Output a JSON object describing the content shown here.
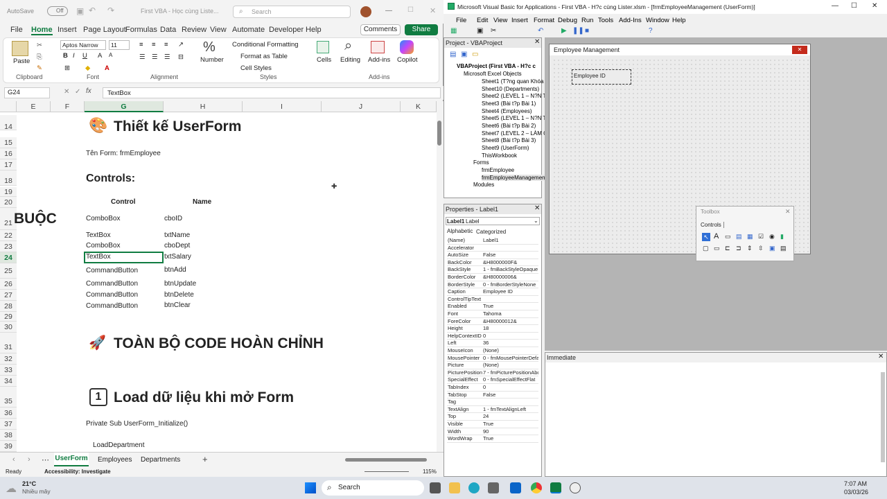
{
  "excel": {
    "title": {
      "autosave": "AutoSave",
      "toggle": "Off",
      "doc": "First VBA - Học cùng Liste...",
      "search_placeholder": "Search"
    },
    "tabs": [
      "File",
      "Home",
      "Insert",
      "Page Layout",
      "Formulas",
      "Data",
      "Review",
      "View",
      "Automate",
      "Developer",
      "Help"
    ],
    "comments": "Comments",
    "share": "Share",
    "ribbon": {
      "paste": "Paste",
      "clipboard": "Clipboard",
      "font_name": "Aptos Narrow",
      "font_size": "11",
      "font": "Font",
      "alignment": "Alignment",
      "number": "Number",
      "cond_format": "Conditional Formatting",
      "format_table": "Format as Table",
      "cell_styles": "Cell Styles",
      "styles": "Styles",
      "cells": "Cells",
      "editing": "Editing",
      "addins": "Add-ins",
      "addins_group": "Add-ins",
      "copilot": "Copilot"
    },
    "namebox": "G24",
    "formula": "TextBox",
    "columns": [
      "E",
      "F",
      "G",
      "H",
      "I",
      "J",
      "K"
    ],
    "rows": [
      "14",
      "15",
      "16",
      "17",
      "18",
      "19",
      "20",
      "21",
      "22",
      "23",
      "24",
      "25",
      "26",
      "27",
      "28",
      "29",
      "30",
      "31",
      "32",
      "33",
      "34",
      "35",
      "36",
      "37",
      "38",
      "39"
    ],
    "cells": {
      "title1": "Thiết kế UserForm",
      "form_name": "Tên Form: frmEmployee",
      "controls": "Controls:",
      "hdr_control": "Control",
      "hdr_name": "Name",
      "buoc": "BUỘC",
      "ctrl_rows": [
        [
          "ComboBox",
          "cboID"
        ],
        [
          "TextBox",
          "txtName"
        ],
        [
          "ComboBox",
          "cboDept"
        ],
        [
          "TextBox",
          "txtSalary"
        ],
        [
          "CommandButton",
          "btnAdd"
        ],
        [
          "CommandButton",
          "btnUpdate"
        ],
        [
          "CommandButton",
          "btnDelete"
        ],
        [
          "CommandButton",
          "btnClear"
        ]
      ],
      "title2": "TOÀN BỘ CODE HOÀN CHỈNH",
      "title3": "Load dữ liệu khi mở Form",
      "num": "1",
      "code1": "Private Sub UserForm_Initialize()",
      "code2": "LoadDepartment"
    },
    "sheets": [
      "UserForm",
      "Employees",
      "Departments"
    ],
    "status": {
      "ready": "Ready",
      "access": "Accessibility: Investigate",
      "zoom": "115%"
    }
  },
  "vbe": {
    "title": "Microsoft Visual Basic for Applications - First VBA - H?c cùng Lister.xlsm - [frmEmployeeManagement (UserForm)]",
    "menu": [
      "File",
      "Edit",
      "View",
      "Insert",
      "Format",
      "Debug",
      "Run",
      "Tools",
      "Add-Ins",
      "Window",
      "Help"
    ],
    "project_title": "Project - VBAProject",
    "tree": [
      "VBAProject (First VBA - H?c c",
      "Microsoft Excel Objects",
      "Sheet1 (T?ng quan Khóa h",
      "Sheet10 (Departments)",
      "Sheet2 (LEVEL 1 – N?N T?",
      "Sheet3 (Bài t?p Bài 1)",
      "Sheet4 (Employees)",
      "Sheet5 (LEVEL 1 – N?N T?",
      "Sheet6 (Bài t?p Bài 2)",
      "Sheet7 (LEVEL 2 – LÀM CH",
      "Sheet8 (Bài t?p Bài 3)",
      "Sheet9 (UserForm)",
      "ThisWorkbook",
      "Forms",
      "frmEmployee",
      "frmEmployeeManagement",
      "Modules"
    ],
    "props_title": "Properties - Label1",
    "props_obj": "Label1",
    "props_type": "Label",
    "props_tabs": [
      "Alphabetic",
      "Categorized"
    ],
    "props": [
      [
        "(Name)",
        "Label1"
      ],
      [
        "Accelerator",
        ""
      ],
      [
        "AutoSize",
        "False"
      ],
      [
        "BackColor",
        "&H8000000F&"
      ],
      [
        "BackStyle",
        "1 - fmBackStyleOpaque"
      ],
      [
        "BorderColor",
        "&H80000006&"
      ],
      [
        "BorderStyle",
        "0 - fmBorderStyleNone"
      ],
      [
        "Caption",
        "Employee ID"
      ],
      [
        "ControlTipText",
        ""
      ],
      [
        "Enabled",
        "True"
      ],
      [
        "Font",
        "Tahoma"
      ],
      [
        "ForeColor",
        "&H80000012&"
      ],
      [
        "Height",
        "18"
      ],
      [
        "HelpContextID",
        "0"
      ],
      [
        "Left",
        "36"
      ],
      [
        "MouseIcon",
        "(None)"
      ],
      [
        "MousePointer",
        "0 - fmMousePointerDefau"
      ],
      [
        "Picture",
        "(None)"
      ],
      [
        "PicturePosition",
        "7 - fmPicturePositionAbov"
      ],
      [
        "SpecialEffect",
        "0 - fmSpecialEffectFlat"
      ],
      [
        "TabIndex",
        "0"
      ],
      [
        "TabStop",
        "False"
      ],
      [
        "Tag",
        ""
      ],
      [
        "TextAlign",
        "1 - fmTextAlignLeft"
      ],
      [
        "Top",
        "24"
      ],
      [
        "Visible",
        "True"
      ],
      [
        "Width",
        "90"
      ],
      [
        "WordWrap",
        "True"
      ]
    ],
    "form_caption": "Employee Management",
    "label_caption": "Employee ID",
    "toolbox_title": "Toolbox",
    "toolbox_tab": "Controls",
    "immediate": "Immediate"
  },
  "taskbar": {
    "weather_temp": "21°C",
    "weather_desc": "Nhiều mây",
    "search": "Search",
    "time": "7:07 AM",
    "date": "03/03/26"
  }
}
